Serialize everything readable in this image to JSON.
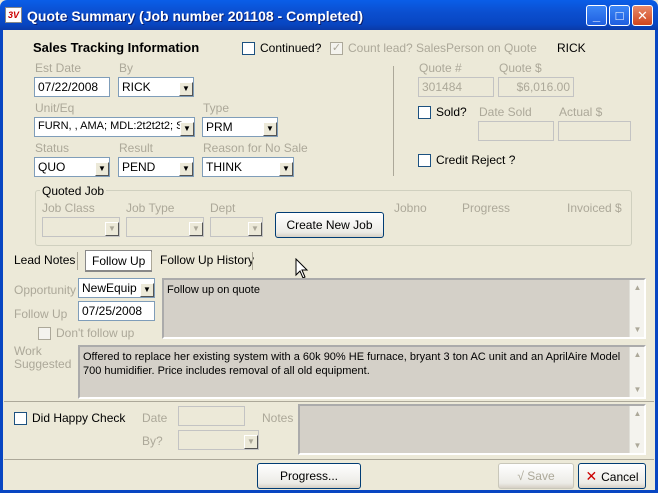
{
  "window": {
    "title": "Quote Summary  (Job number 201108 - Completed)",
    "app_icon_text": "3V"
  },
  "sales": {
    "heading": "Sales Tracking Information",
    "continued_label": "Continued?",
    "count_lead_label": "Count lead?",
    "salesperson_label": "SalesPerson on Quote",
    "salesperson_value": "RICK",
    "est_date_label": "Est Date",
    "est_date_value": "07/22/2008",
    "by_label": "By",
    "by_value": "RICK",
    "unit_label": "Unit/Eq",
    "unit_value": "FURN, , AMA; MDL:2t2t2t2; S",
    "type_label": "Type",
    "type_value": "PRM",
    "status_label": "Status",
    "status_value": "QUO",
    "result_label": "Result",
    "result_value": "PEND",
    "reason_label": "Reason for No Sale",
    "reason_value": "THINK",
    "quote_num_label": "Quote #",
    "quote_num_value": "301484",
    "quote_amt_label": "Quote $",
    "quote_amt_value": "$6,016.00",
    "sold_label": "Sold?",
    "date_sold_label": "Date Sold",
    "actual_label": "Actual $",
    "credit_reject_label": "Credit Reject ?"
  },
  "quoted_job": {
    "title": "Quoted Job",
    "job_class_label": "Job Class",
    "job_type_label": "Job Type",
    "dept_label": "Dept",
    "create_button": "Create New Job",
    "jobno_label": "Jobno",
    "progress_label": "Progress",
    "invoiced_label": "Invoiced $"
  },
  "tabs": [
    "Lead Notes",
    "Follow Up",
    "Follow Up History"
  ],
  "followup": {
    "opportunity_label": "Opportunity",
    "opportunity_value": "NewEquip",
    "followup_label": "Follow Up",
    "followup_value": "07/25/2008",
    "dont_follow_label": "Don't follow up",
    "notes_text": "Follow up on quote",
    "work_label": "Work\nSuggested",
    "work_text": "Offered to replace her existing system with a 60k 90% HE furnace, bryant 3 ton AC unit and an AprilAire Model 700 humidifier. Price includes removal of all old equipment."
  },
  "happy": {
    "label": "Did Happy Check",
    "date_label": "Date",
    "by_label": "By?",
    "notes_label": "Notes"
  },
  "buttons": {
    "progress": "Progress...",
    "save": "Save",
    "cancel": "Cancel"
  }
}
